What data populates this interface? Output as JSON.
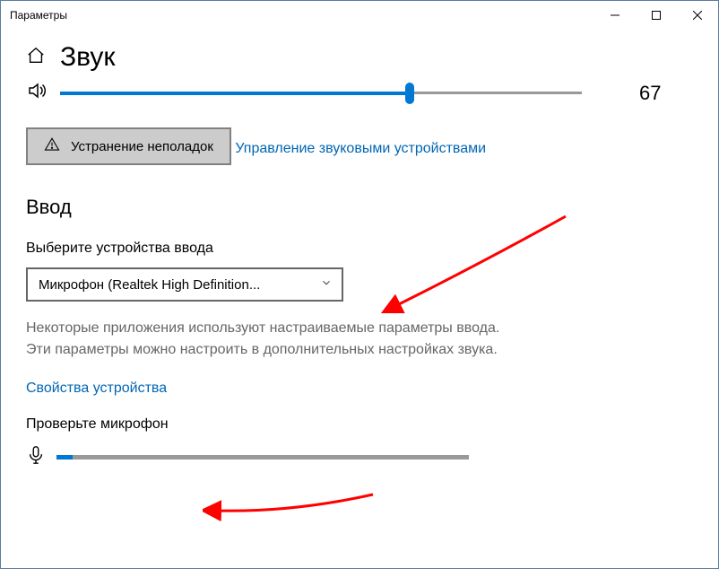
{
  "window": {
    "title": "Параметры"
  },
  "page": {
    "title": "Звук"
  },
  "output": {
    "volume_percent": 67,
    "volume_display": "67",
    "troubleshoot_label": "Устранение неполадок",
    "manage_devices_label": "Управление звуковыми устройствами"
  },
  "input": {
    "section_title": "Ввод",
    "select_label": "Выберите устройства ввода",
    "selected_device": "Микрофон (Realtek High Definition...",
    "description": "Некоторые приложения используют настраиваемые параметры ввода. Эти параметры можно настроить в дополнительных настройках звука.",
    "properties_label": "Свойства устройства",
    "test_label": "Проверьте микрофон",
    "mic_level_percent": 4
  },
  "colors": {
    "accent": "#0078d4",
    "link": "#0066b4",
    "muted": "#666"
  }
}
